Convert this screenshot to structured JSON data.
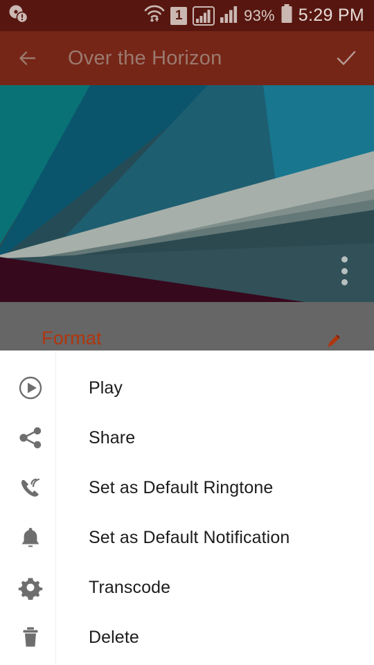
{
  "status_bar": {
    "background_color": "#571710",
    "text_color": "#d9c9c4",
    "notification_icon": "disc-alert-icon",
    "wifi_icon": "wifi-icon",
    "sim_label": "1",
    "signal1_icon": "signal-bars-framed-icon",
    "signal2_icon": "signal-bars-icon",
    "battery_percent": "93%",
    "battery_icon": "battery-icon",
    "time": "5:29 PM"
  },
  "app_bar": {
    "background_color": "#762617",
    "title": "Over the Horizon",
    "title_color": "#9b7a6f",
    "back_icon": "back-arrow-icon",
    "confirm_icon": "check-icon"
  },
  "artwork": {
    "overflow_icon": "overflow-menu-icon",
    "alt": "abstract geometric wallpaper"
  },
  "detail": {
    "format_label": "Format",
    "format_label_color": "#b0360e",
    "edit_icon": "edit-pencil-icon",
    "scrim_color": "#666666"
  },
  "menu": {
    "items": [
      {
        "label": "Play",
        "icon": "play-circle-icon"
      },
      {
        "label": "Share",
        "icon": "share-icon"
      },
      {
        "label": "Set as Default Ringtone",
        "icon": "ringtone-phone-icon"
      },
      {
        "label": "Set as Default Notification",
        "icon": "bell-icon"
      },
      {
        "label": "Transcode",
        "icon": "gear-icon"
      },
      {
        "label": "Delete",
        "icon": "trash-icon"
      }
    ]
  }
}
